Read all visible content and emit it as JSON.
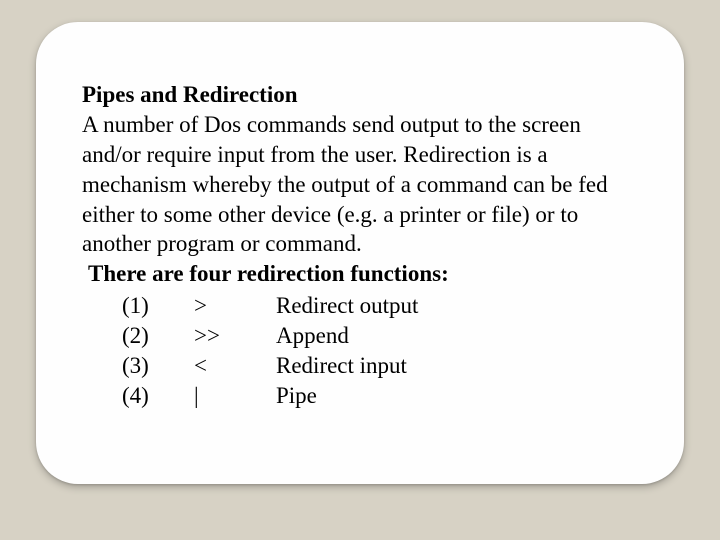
{
  "slide": {
    "title": "Pipes and Redirection",
    "paragraph": "A number of Dos commands send output to the screen and/or require input from the user. Redirection is a mechanism whereby the output of a command can be fed either to some other device (e.g. a printer or file) or to another program or command.",
    "subhead": "There are four redirection functions:",
    "functions": [
      {
        "num": "(1)",
        "sym": ">",
        "desc": "Redirect output"
      },
      {
        "num": "(2)",
        "sym": ">>",
        "desc": "Append"
      },
      {
        "num": "(3)",
        "sym": "<",
        "desc": "Redirect input"
      },
      {
        "num": "(4)",
        "sym": "|",
        "desc": "Pipe"
      }
    ]
  }
}
